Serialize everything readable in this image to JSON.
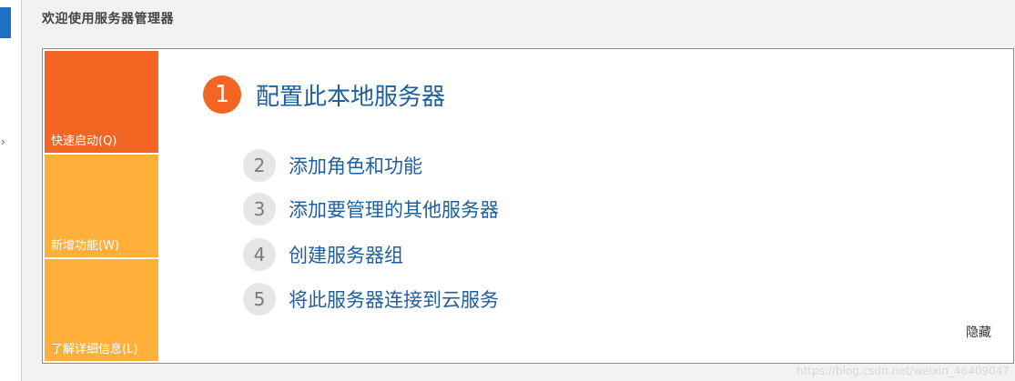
{
  "header": {
    "title": "欢迎使用服务器管理器"
  },
  "tiles": [
    {
      "label": "快速启动(Q)",
      "color": "#f26522"
    },
    {
      "label": "新增功能(W)",
      "color": "#ffb03b"
    },
    {
      "label": "了解详细信息(L)",
      "color": "#ffb03b"
    }
  ],
  "main_step": {
    "number": "1",
    "label": "配置此本地服务器",
    "color": "#f26522"
  },
  "steps": [
    {
      "number": "2",
      "label": "添加角色和功能"
    },
    {
      "number": "3",
      "label": "添加要管理的其他服务器"
    },
    {
      "number": "4",
      "label": "创建服务器组"
    },
    {
      "number": "5",
      "label": "将此服务器连接到云服务"
    }
  ],
  "actions": {
    "hide_label": "隐藏"
  },
  "watermark": "https://blog.csdn.net/weixin_46409047",
  "colors": {
    "accent": "#f26522",
    "tile_secondary": "#ffb03b",
    "link": "#1f5f9e"
  }
}
